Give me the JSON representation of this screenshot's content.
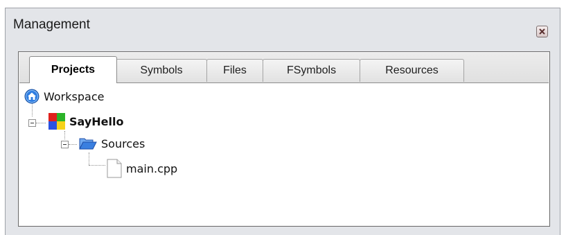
{
  "panel": {
    "title": "Management",
    "close_icon": "close-icon"
  },
  "tabs": [
    {
      "label": "Projects",
      "active": true
    },
    {
      "label": "Symbols",
      "active": false
    },
    {
      "label": "Files",
      "active": false
    },
    {
      "label": "FSymbols",
      "active": false
    },
    {
      "label": "Resources",
      "active": false
    }
  ],
  "tree": {
    "workspace": {
      "label": "Workspace",
      "icon": "workspace-icon"
    },
    "project": {
      "label": "SayHello",
      "icon": "project-icon",
      "expanded": true
    },
    "folder": {
      "label": "Sources",
      "icon": "folder-open-icon",
      "expanded": true
    },
    "file": {
      "label": "main.cpp",
      "icon": "file-icon"
    }
  },
  "colors": {
    "panel_bg": "#e3e5e9",
    "tree_bg": "#ffffff",
    "workspace_blue": "#2f7de1",
    "folder_blue": "#3a7fe0"
  }
}
